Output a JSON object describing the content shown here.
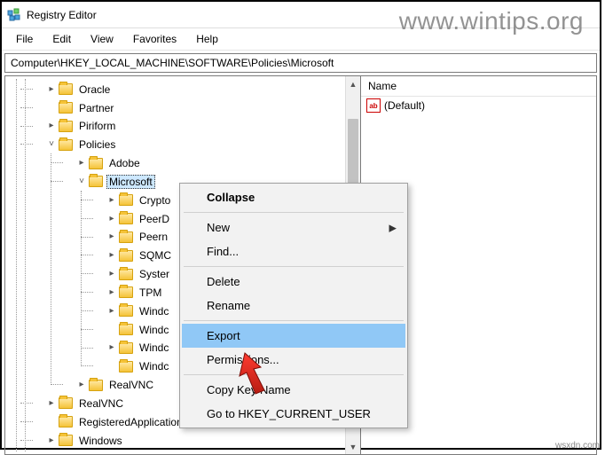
{
  "window": {
    "title": "Registry Editor"
  },
  "menubar": [
    "File",
    "Edit",
    "View",
    "Favorites",
    "Help"
  ],
  "address": "Computer\\HKEY_LOCAL_MACHINE\\SOFTWARE\\Policies\\Microsoft",
  "tree": {
    "nodes": [
      "Oracle",
      "Partner",
      "Piriform",
      "Policies",
      "Adobe",
      "Microsoft",
      "Cryptography",
      "PeerDist",
      "Peernet",
      "SQMClient",
      "SystemCertificates",
      "TPM",
      "Windows",
      "Windows Defender",
      "Windows NT",
      "WindowsStore",
      "RealVNC",
      "RealVNC",
      "RegisteredApplications",
      "Windows"
    ],
    "labels": {
      "oracle": "Oracle",
      "partner": "Partner",
      "piriform": "Piriform",
      "policies": "Policies",
      "adobe": "Adobe",
      "microsoft": "Microsoft",
      "crypto": "Crypto",
      "peerdist": "PeerD",
      "peernet": "Peern",
      "sqm": "SQMC",
      "syscert": "Syster",
      "tpm": "TPM",
      "win1": "Windc",
      "win2": "Windc",
      "win3": "Windc",
      "win4": "Windc",
      "realvnc1": "RealVNC",
      "realvnc2": "RealVNC",
      "regapps": "RegisteredApplications",
      "windows": "Windows"
    }
  },
  "values": {
    "header": "Name",
    "default": "(Default)"
  },
  "context_menu": {
    "collapse": "Collapse",
    "new": "New",
    "find": "Find...",
    "delete": "Delete",
    "rename": "Rename",
    "export": "Export",
    "permissions": "Permissions...",
    "copykey": "Copy Key Name",
    "goto": "Go to HKEY_CURRENT_USER"
  },
  "watermark": "www.wintips.org",
  "attribution": "wsxdn.com"
}
